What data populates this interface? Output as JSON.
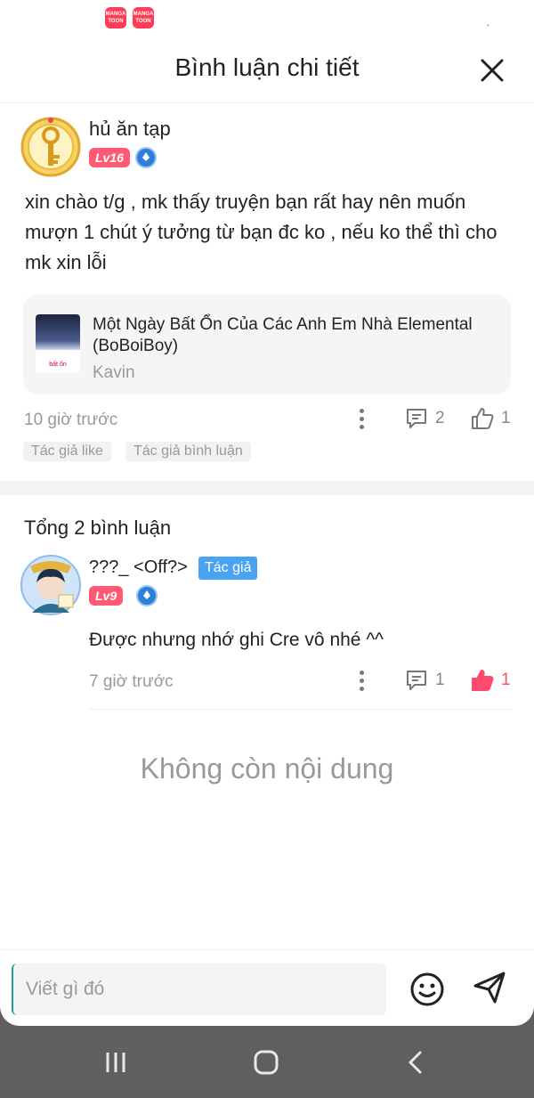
{
  "status_bar": {
    "app_badges": [
      "MANGA TOON",
      "MANGA TOON"
    ],
    "signal": "ˏ"
  },
  "header": {
    "title": "Bình luận chi tiết"
  },
  "post": {
    "username": "hủ ăn tạp",
    "level": "Lv16",
    "text": "xin chào t/g , mk thấy truyện bạn rất hay nên muốn mượn 1 chút ý tưởng từ bạn đc ko , nếu ko thể thì cho mk xin lỗi",
    "work": {
      "title": "Một Ngày Bất Ổn Của Các Anh Em Nhà Elemental (BoBoiBoy)",
      "author": "Kavin",
      "cover_text": "bất ổn"
    },
    "time": "10 giờ trước",
    "reply_count": "2",
    "like_count": "1",
    "tags": [
      "Tác giả like",
      "Tác giả bình luận"
    ]
  },
  "comments": {
    "total_label": "Tổng 2 bình luận",
    "items": [
      {
        "username": "???_ <Off?>",
        "author_tag": "Tác giả",
        "level": "Lv9",
        "text": "Được nhưng nhớ ghi Cre vô nhé ^^",
        "time": "7 giờ trước",
        "reply_count": "1",
        "like_count": "1",
        "liked": true
      }
    ],
    "end_label": "Không còn nội dung"
  },
  "composer": {
    "placeholder": "Viết gì đó"
  },
  "colors": {
    "accent": "#ff4a6b",
    "author_tag": "#4aa3f0",
    "level_badge": "#ff5a73",
    "medal": "#2f7fd8"
  },
  "icons": [
    "close-icon",
    "more-icon",
    "comment-icon",
    "thumb-up-icon",
    "emoji-icon",
    "send-icon",
    "recent-apps-icon",
    "home-icon",
    "back-icon"
  ]
}
